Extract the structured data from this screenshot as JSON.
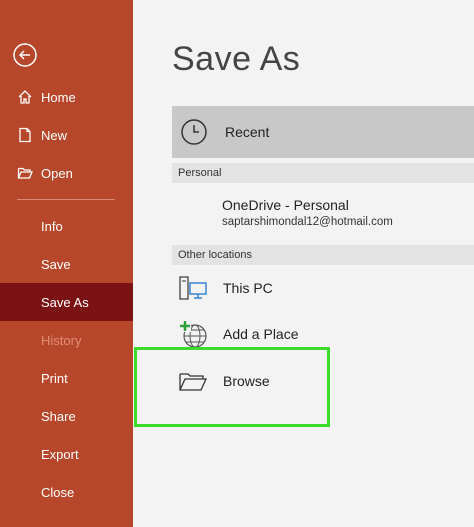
{
  "sidebar": {
    "items": [
      {
        "id": "home",
        "label": "Home",
        "icon": "home-icon"
      },
      {
        "id": "new",
        "label": "New",
        "icon": "new-document-icon"
      },
      {
        "id": "open",
        "label": "Open",
        "icon": "open-folder-icon"
      },
      {
        "id": "info",
        "label": "Info"
      },
      {
        "id": "save",
        "label": "Save"
      },
      {
        "id": "save-as",
        "label": "Save As",
        "selected": true
      },
      {
        "id": "history",
        "label": "History",
        "disabled": true
      },
      {
        "id": "print",
        "label": "Print"
      },
      {
        "id": "share",
        "label": "Share"
      },
      {
        "id": "export",
        "label": "Export"
      },
      {
        "id": "close",
        "label": "Close"
      }
    ],
    "back_icon": "back-arrow-icon"
  },
  "main": {
    "title": "Save As",
    "recent": {
      "label": "Recent",
      "icon": "clock-icon"
    },
    "personal": {
      "header": "Personal",
      "onedrive_name": "OneDrive - Personal",
      "onedrive_email": "saptarshimondal12@hotmail.com"
    },
    "other": {
      "header": "Other locations",
      "items": [
        {
          "label": "This PC",
          "icon": "computer-icon"
        },
        {
          "label": "Add a Place",
          "icon": "add-globe-icon"
        },
        {
          "label": "Browse",
          "icon": "folder-icon"
        }
      ]
    }
  },
  "colors": {
    "sidebar": "#b7472a",
    "sidebar_selected": "#7b1214",
    "highlight": "#3ddc2a"
  }
}
